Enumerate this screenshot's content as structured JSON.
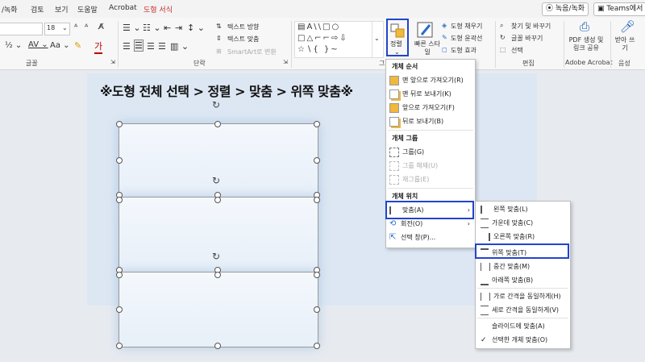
{
  "menubar": {
    "tabs": [
      "/녹화",
      "검토",
      "보기",
      "도움말",
      "Acrobat",
      "도형 서식"
    ],
    "record_button": "녹음/녹화",
    "teams_button": "Teams에서"
  },
  "ribbon": {
    "font_size": "18",
    "font_group_label": "글꼴",
    "paragraph_group_label": "단락",
    "text_direction": "텍스트 방향",
    "text_align": "텍스트 맞춤",
    "smartart": "SmartArt로 변환",
    "arrange_button": "정렬",
    "quick_styles": "빠른 스타일",
    "shape_fill": "도형 채우기",
    "shape_outline": "도형 윤곽선",
    "shape_effects": "도형 효과",
    "find_replace": "찾기 및 바꾸기",
    "replace_font": "글꼴 바꾸기",
    "select": "선택",
    "edit_group_label": "편집",
    "pdf_share": "PDF 생성 및 링크 공유",
    "adobe_label": "Adobe Acrobat",
    "dictate": "받아 쓰기",
    "voice_label": "음성"
  },
  "slide": {
    "title": "※도형 전체 선택 > 정렬 > 맞춤 > 위쪽 맞춤※"
  },
  "arrange_menu": {
    "header_order": "개체 순서",
    "bring_to_front": "맨 앞으로 가져오기(R)",
    "send_to_back": "맨 뒤로 보내기(K)",
    "bring_forward": "앞으로 가져오기(F)",
    "send_backward": "뒤로 보내기(B)",
    "header_group": "개체 그룹",
    "group": "그룹(G)",
    "ungroup": "그룹 해제(U)",
    "regroup": "재그룹(E)",
    "header_position": "개체 위치",
    "align": "맞춤(A)",
    "rotate": "회전(O)",
    "selection_pane": "선택 창(P)..."
  },
  "align_menu": {
    "align_left": "왼쪽 맞춤(L)",
    "align_center": "가운데 맞춤(C)",
    "align_right": "오른쪽 맞춤(R)",
    "align_top": "위쪽 맞춤(T)",
    "align_middle": "중간 맞춤(M)",
    "align_bottom": "아래쪽 맞춤(B)",
    "distribute_h": "가로 간격을 동일하게(H)",
    "distribute_v": "세로 간격을 동일하게(V)",
    "align_to_slide": "슬라이드에 맞춤(A)",
    "align_selected": "선택한 개체 맞춤(O)"
  }
}
